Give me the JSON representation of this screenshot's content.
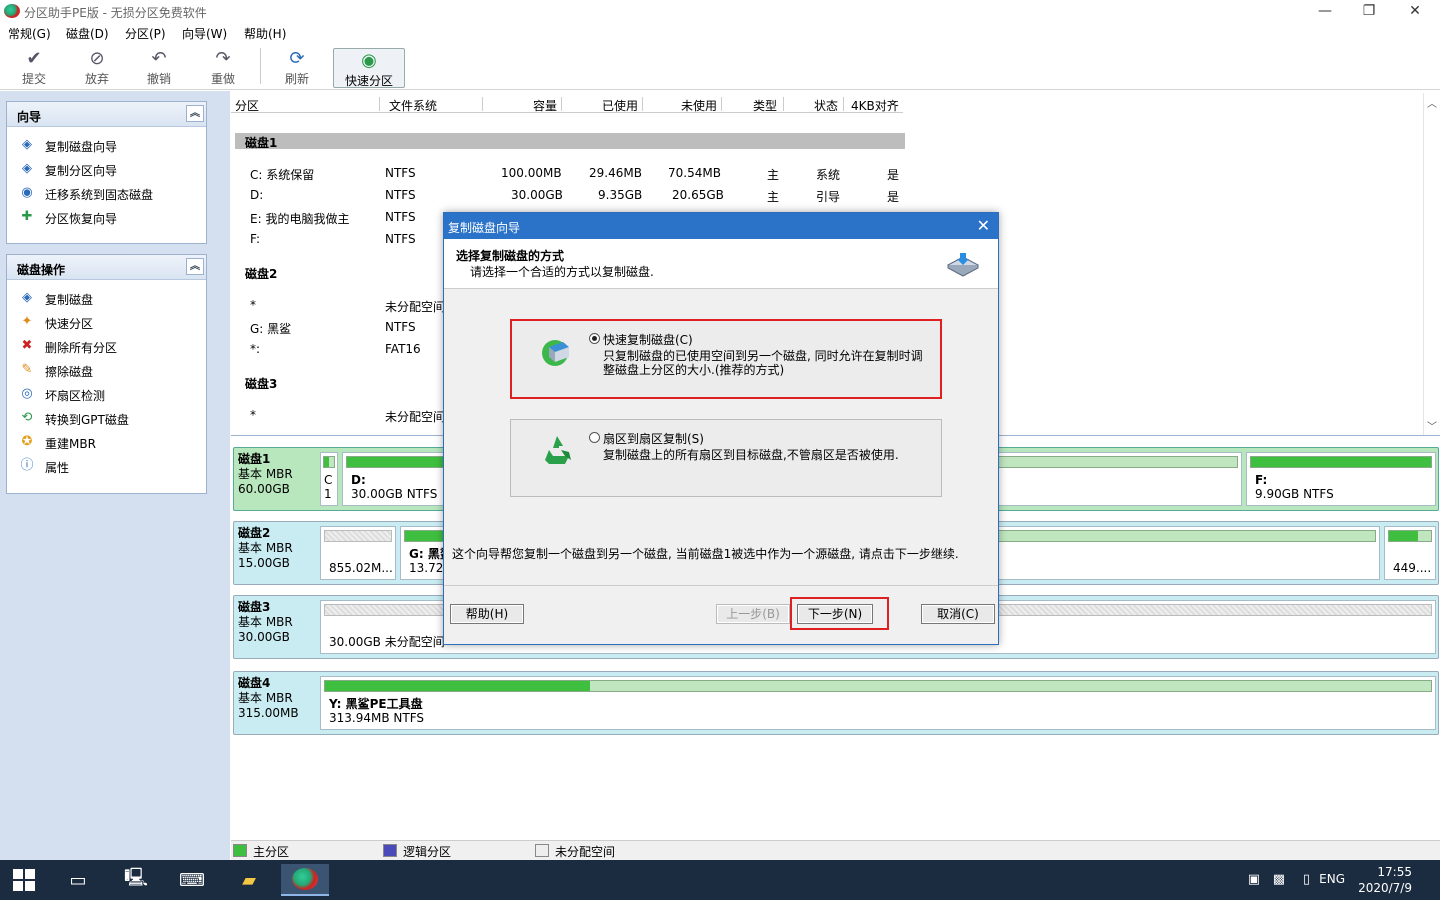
{
  "window": {
    "title": "分区助手PE版 - 无损分区免费软件",
    "min": "—",
    "max": "❐",
    "close": "✕"
  },
  "menu": [
    "常规(G)",
    "磁盘(D)",
    "分区(P)",
    "向导(W)",
    "帮助(H)"
  ],
  "toolbar": [
    {
      "label": "提交",
      "icon": "✔"
    },
    {
      "label": "放弃",
      "icon": "⊘"
    },
    {
      "label": "撤销",
      "icon": "↶"
    },
    {
      "label": "重做",
      "icon": "↷"
    },
    {
      "label": "刷新",
      "icon": "⟳"
    },
    {
      "label": "快速分区",
      "icon": "◉"
    }
  ],
  "wizard_panel": {
    "title": "向导",
    "collapse": "︽",
    "items": [
      "复制磁盘向导",
      "复制分区向导",
      "迁移系统到固态磁盘",
      "分区恢复向导"
    ]
  },
  "disk_ops_panel": {
    "title": "磁盘操作",
    "collapse": "︽",
    "items": [
      "复制磁盘",
      "快速分区",
      "删除所有分区",
      "擦除磁盘",
      "坏扇区检测",
      "转换到GPT磁盘",
      "重建MBR",
      "属性"
    ]
  },
  "table": {
    "columns": [
      "分区",
      "文件系统",
      "容量",
      "已使用",
      "未使用",
      "类型",
      "状态",
      "4KB对齐"
    ],
    "disk1": "磁盘1",
    "disk1_rows": [
      {
        "name": "C: 系统保留",
        "fs": "NTFS",
        "cap": "100.00MB",
        "used": "29.46MB",
        "free": "70.54MB",
        "type": "主",
        "status": "系统",
        "align": "是"
      },
      {
        "name": "D:",
        "fs": "NTFS",
        "cap": "30.00GB",
        "used": "9.35GB",
        "free": "20.65GB",
        "type": "主",
        "status": "引导",
        "align": "是"
      },
      {
        "name": "E: 我的电脑我做主",
        "fs": "NTFS"
      },
      {
        "name": "F:",
        "fs": "NTFS"
      }
    ],
    "disk2": "磁盘2",
    "disk2_rows": [
      {
        "name": "*",
        "fs": "未分配空间"
      },
      {
        "name": "G: 黑鲨",
        "fs": "NTFS"
      },
      {
        "name": "*:",
        "fs": "FAT16"
      }
    ],
    "disk3": "磁盘3",
    "disk3_rows": [
      {
        "name": "*",
        "fs": "未分配空间"
      }
    ]
  },
  "diskmap": [
    {
      "name": "磁盘1",
      "type": "基本 MBR",
      "size": "60.00GB",
      "parts": [
        {
          "l1": "C",
          "l2": "1"
        },
        {
          "l1": "D:",
          "l2": "30.00GB NTFS"
        },
        {
          "l1": "F:",
          "l2": "9.90GB NTFS"
        }
      ]
    },
    {
      "name": "磁盘2",
      "type": "基本 MBR",
      "size": "15.00GB",
      "parts": [
        {
          "l1": "",
          "l2": "855.02M..."
        },
        {
          "l1": "G: 黑鲨",
          "l2": "13.72G"
        },
        {
          "l1": "",
          "l2": "449...."
        }
      ]
    },
    {
      "name": "磁盘3",
      "type": "基本 MBR",
      "size": "30.00GB",
      "parts": [
        {
          "l1": "",
          "l2": "30.00GB 未分配空间"
        }
      ]
    },
    {
      "name": "磁盘4",
      "type": "基本 MBR",
      "size": "315.00MB",
      "parts": [
        {
          "l1": "Y: 黑鲨PE工具盘",
          "l2": "313.94MB NTFS"
        }
      ]
    }
  ],
  "legend": [
    "主分区",
    "逻辑分区",
    "未分配空间"
  ],
  "dialog": {
    "title": "复制磁盘向导",
    "heading": "选择复制磁盘的方式",
    "subheading": "请选择一个合适的方式以复制磁盘.",
    "option1_label": "快速复制磁盘(C)",
    "option1_desc": "只复制磁盘的已使用空间到另一个磁盘, 同时允许在复制时调整磁盘上分区的大小.(推荐的方式)",
    "option2_label": "扇区到扇区复制(S)",
    "option2_desc": "复制磁盘上的所有扇区到目标磁盘,不管扇区是否被使用.",
    "info": "这个向导帮您复制一个磁盘到另一个磁盘, 当前磁盘1被选中作为一个源磁盘, 请点击下一步继续.",
    "help": "帮助(H)",
    "back": "上一步(B)",
    "next": "下一步(N)",
    "cancel": "取消(C)",
    "close": "✕"
  },
  "taskbar": {
    "lang": "ENG",
    "time": "17:55",
    "date": "2020/7/9"
  }
}
